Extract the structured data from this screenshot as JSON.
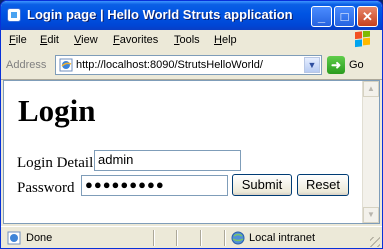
{
  "window": {
    "title": "Login page | Hello World Struts application",
    "controls": {
      "minimize": "_",
      "maximize": "□",
      "close": "✕"
    }
  },
  "menu": [
    "File",
    "Edit",
    "View",
    "Favorites",
    "Tools",
    "Help"
  ],
  "address": {
    "label": "Address",
    "url": "http://localhost:8090/StrutsHelloWorld/",
    "go_label": "Go"
  },
  "page": {
    "heading": "Login",
    "username_label": "Login Detail",
    "username_value": "admin",
    "password_label": "Password",
    "password_display": "●●●●●●●●●",
    "submit_label": "Submit",
    "reset_label": "Reset"
  },
  "status": {
    "text": "Done",
    "zone": "Local intranet"
  },
  "colors": {
    "titlebar": "#0054e3",
    "chrome": "#ece9d8",
    "close_button": "#c4401e",
    "go_button": "#2a9b1e"
  },
  "icons": {
    "app": "ie-page-icon",
    "windows_logo": "windows-flag-icon",
    "go": "go-arrow-icon",
    "status": "page-done-icon",
    "zone": "intranet-globe-icon"
  }
}
